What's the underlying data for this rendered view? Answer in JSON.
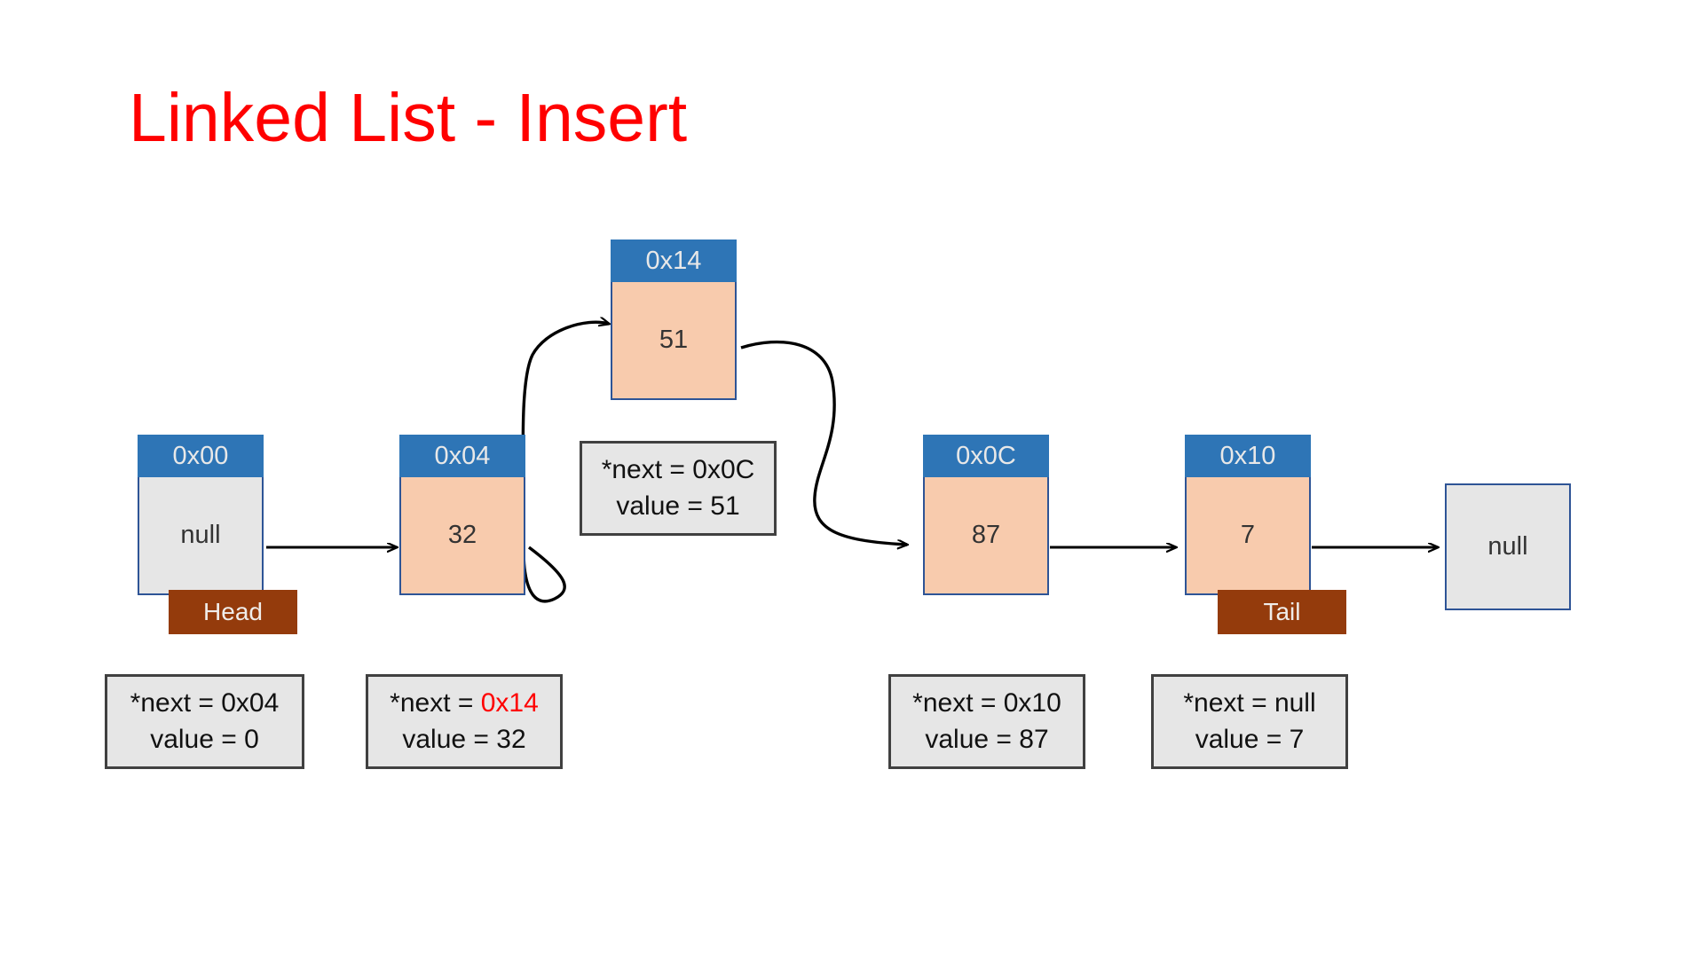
{
  "slide": {
    "title": "Linked List - Insert",
    "title_color": "#FF0000",
    "background": "#FFFFFF"
  },
  "palette": {
    "node_header": "#2E75B6",
    "node_data_body": "#F8CBAD",
    "node_null_body": "#E6E6E6",
    "node_border": "#2E5496",
    "badge": "#943B0C",
    "infobox_bg": "#E6E6E6",
    "infobox_border": "#404040",
    "highlight": "#FF0000",
    "arrow": "#000000"
  },
  "nodes": [
    {
      "address": "0x00",
      "value": "null",
      "kind": "null"
    },
    {
      "address": "0x04",
      "value": "32",
      "kind": "data"
    },
    {
      "address": "0x14",
      "value": "51",
      "kind": "data"
    },
    {
      "address": "0x0C",
      "value": "87",
      "kind": "data"
    },
    {
      "address": "0x10",
      "value": "7",
      "kind": "data"
    }
  ],
  "terminal": {
    "label": "null"
  },
  "badges": {
    "head": "Head",
    "tail": "Tail"
  },
  "infoboxes": [
    {
      "id": "info-0x00",
      "next_label": "*next = ",
      "next_value": "0x04",
      "next_highlight": false,
      "value_line": "value = 0"
    },
    {
      "id": "info-0x04",
      "next_label": "*next = ",
      "next_value": "0x14",
      "next_highlight": true,
      "value_line": "value = 32"
    },
    {
      "id": "info-0x14",
      "next_label": "*next = ",
      "next_value": "0x0C",
      "next_highlight": false,
      "value_line": "value = 51"
    },
    {
      "id": "info-0x0C",
      "next_label": "*next = ",
      "next_value": "0x10",
      "next_highlight": false,
      "value_line": "value = 87"
    },
    {
      "id": "info-0x10",
      "next_label": "*next = ",
      "next_value": "null",
      "next_highlight": false,
      "value_line": "value = 7"
    }
  ]
}
